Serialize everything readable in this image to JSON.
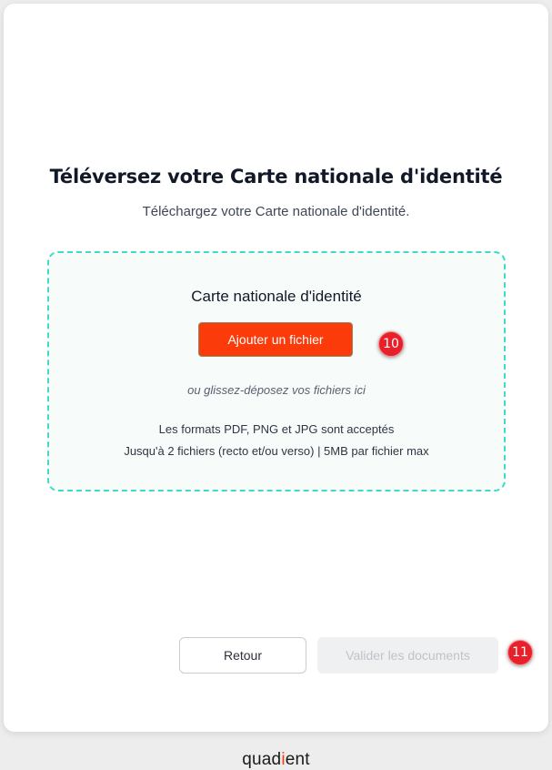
{
  "header": {
    "title": "Téléversez votre Carte nationale d'identité",
    "subtitle": "Téléchargez votre Carte nationale d'identité."
  },
  "dropzone": {
    "document_label": "Carte nationale d'identité",
    "upload_button": "Ajouter un fichier",
    "drag_hint": "ou glissez-déposez vos fichiers ici",
    "formats_text": "Les formats PDF, PNG et JPG sont acceptés",
    "limits_text": "Jusqu'à 2 fichiers (recto et/ou verso) | 5MB par fichier max"
  },
  "annotations": {
    "upload_marker": "10",
    "validate_marker": "11"
  },
  "footer": {
    "back_button": "Retour",
    "validate_button": "Valider les documents",
    "validate_enabled": false
  },
  "brand": {
    "logo_start": "quad",
    "logo_accent": "i",
    "logo_end": "ent",
    "accent_color": "#fc3b0b",
    "dropzone_border_color": "#3ddcc6"
  }
}
